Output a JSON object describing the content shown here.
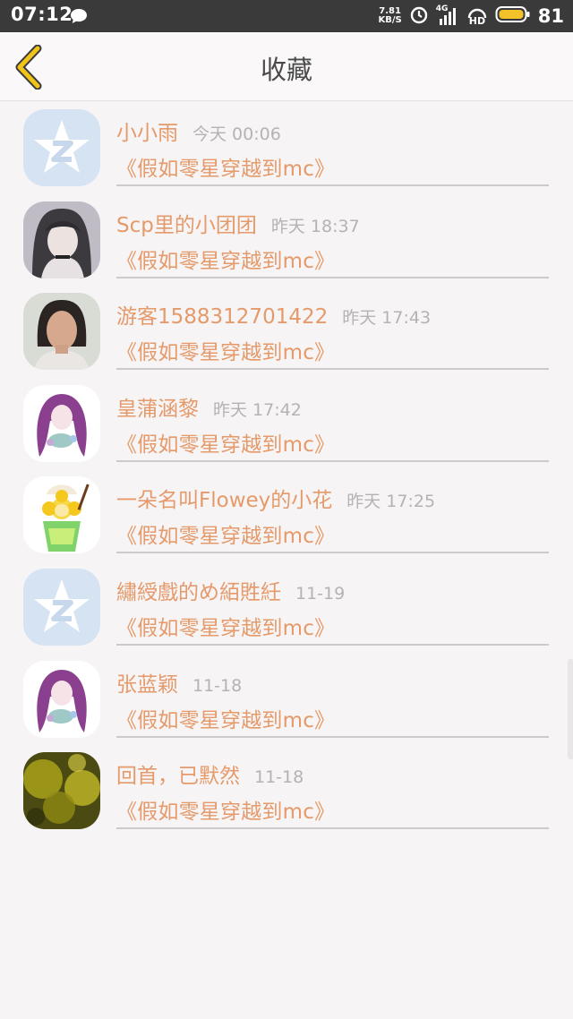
{
  "status": {
    "time": "07:12",
    "net_speed": "7.81",
    "net_unit": "KB/S",
    "signal_label": "4G",
    "hd_label": "HD",
    "battery": "81"
  },
  "header": {
    "title": "收藏"
  },
  "items": [
    {
      "name": "小小雨",
      "time": "今天 00:06",
      "work": "《假如零星穿越到mc》",
      "avatar": "qq-default-avatar"
    },
    {
      "name": "Scp里的小团团",
      "time": "昨天 18:37",
      "work": "《假如零星穿越到mc》",
      "avatar": "anime-girl-avatar"
    },
    {
      "name": "游客1588312701422",
      "time": "昨天 17:43",
      "work": "《假如零星穿越到mc》",
      "avatar": "photo-avatar"
    },
    {
      "name": "皇蒲涵黎",
      "time": "昨天 17:42",
      "work": "《假如零星穿越到mc》",
      "avatar": "purple-hair-avatar"
    },
    {
      "name": "一朵名叫Flowey的小花",
      "time": "昨天 17:25",
      "work": "《假如零星穿越到mc》",
      "avatar": "flower-drink-avatar"
    },
    {
      "name": "繡綬戲的め絔貹紝",
      "time": "11-19",
      "work": "《假如零星穿越到mc》",
      "avatar": "qq-default-avatar"
    },
    {
      "name": "张蓝颖",
      "time": "11-18",
      "work": "《假如零星穿越到mc》",
      "avatar": "purple-hair-avatar"
    },
    {
      "name": "回首，已默然",
      "time": "11-18",
      "work": "《假如零星穿越到mc》",
      "avatar": "golden-blur-avatar"
    }
  ],
  "colors": {
    "accent": "#e49a6a",
    "back_arrow": "#f0c419",
    "time_text": "#b5b2b3"
  }
}
